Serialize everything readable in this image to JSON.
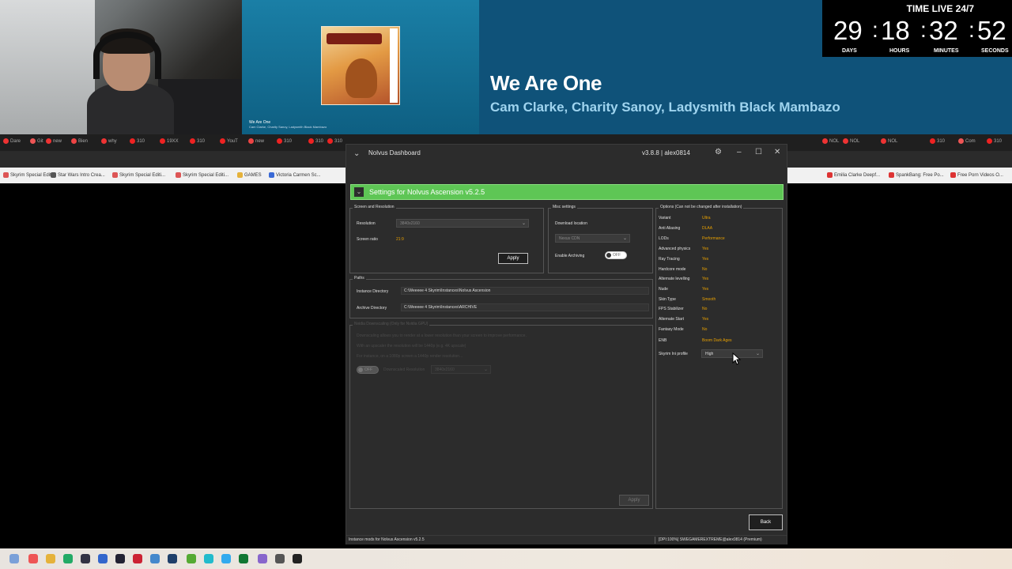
{
  "overlay": {
    "now_playing": {
      "song": "We Are One",
      "artists": "Cam Clarke, Charity Sanoy, Ladysmith Black Mambazo",
      "small_title": "We Are One",
      "small_artists": "Cam Clarke, Charity Sanoy, Ladysmith Black Mambazo"
    },
    "timer": {
      "label": "TIME LIVE 24/7",
      "days": "29",
      "hours": "18",
      "minutes": "32",
      "seconds": "52",
      "sep": ":",
      "days_label": "DAYS",
      "hours_label": "HOURS",
      "minutes_label": "MINUTES",
      "seconds_label": "SECONDS"
    }
  },
  "browser": {
    "tabs": [
      "Dare",
      "Git",
      "new",
      "Bien",
      "why",
      "310",
      "19XX",
      "310",
      "YouT",
      "new",
      "310",
      "310",
      "310"
    ],
    "tabs_right": [
      "NOL",
      "NOL",
      "NOL",
      "310",
      "Com",
      "310"
    ],
    "bookmarks": [
      "Skyrim Special Editi...",
      "Star Wars Intro Crea...",
      "Skyrim Special Editi...",
      "Skyrim Special Editi...",
      "GAMES",
      "Victoria Carmen Sc..."
    ],
    "bookmarks_right": [
      "Emilia Clarke Deepf...",
      "SpankBang: Free Po...",
      "Free Porn Videos O..."
    ]
  },
  "app": {
    "logo": "⌄",
    "title": "Nolvus Dashboard",
    "version": "v3.8.8 | alex0814",
    "banner": "Settings for Nolvus Ascension v5.2.5",
    "screen": {
      "group_title": "Screen and Resolution",
      "resolution_label": "Resolution",
      "resolution_value": "3840x2160",
      "ratio_label": "Screen ratio",
      "ratio_value": "21:9",
      "apply_label": "Apply"
    },
    "misc": {
      "group_title": "Misc settings",
      "download_label": "Download location",
      "download_value": "Nexus CDN",
      "archiving_label": "Enable Archiving",
      "archiving_state": "OFF"
    },
    "paths": {
      "group_title": "Paths",
      "instance_label": "Instance Directory",
      "instance_value": "C:\\Weeeee 4 Skyrim\\Instances\\Nolvus Ascension",
      "archive_label": "Archive Directory",
      "archive_value": "C:\\Weeeee 4 Skyrim\\Instances\\ARCHIVE"
    },
    "downscaling": {
      "group_title": "Nvidia Downscaling (Only for Nvidia GPU)",
      "line1": "Downscaling allows you to render at a lower resolution than your screen to improve performance.",
      "line2": "With an upscaler the resolution will be 1440p (e.g. 4K upscale)",
      "line3": "For instance, on a 1080p screen a 1440p render resolution...",
      "toggle_state": "OFF",
      "label": "Downscaled Resolution",
      "value": "3840x2160",
      "apply_label": "Apply"
    },
    "options": {
      "group_title": "Options (Can not be changed after installation)",
      "rows": [
        {
          "label": "Variant",
          "value": "Ultra"
        },
        {
          "label": "Anti Aliasing",
          "value": "DLAA"
        },
        {
          "label": "LODs",
          "value": "Performance"
        },
        {
          "label": "Advanced physics",
          "value": "Yes"
        },
        {
          "label": "Ray Tracing",
          "value": "Yes"
        },
        {
          "label": "Hardcore mode",
          "value": "No"
        },
        {
          "label": "Alternate levelling",
          "value": "Yes"
        },
        {
          "label": "Nude",
          "value": "Yes"
        },
        {
          "label": "Skin Type",
          "value": "Smooth"
        },
        {
          "label": "FPS Stabilizer",
          "value": "No"
        },
        {
          "label": "Alternate Start",
          "value": "Yes"
        },
        {
          "label": "Fantasy Mode",
          "value": "No"
        },
        {
          "label": "ENB",
          "value": "Boom Dark Ages"
        }
      ],
      "ini_label": "Skyrim Ini profile",
      "ini_value": "High"
    },
    "back_label": "Back",
    "status_left": "Instance mods for Nolvus Ascension v5.2.5",
    "status_dpi": "[DPI:100%]",
    "status_user": "SWEGAMEREXTREME@alex0814",
    "status_tier": "(Premium)"
  }
}
